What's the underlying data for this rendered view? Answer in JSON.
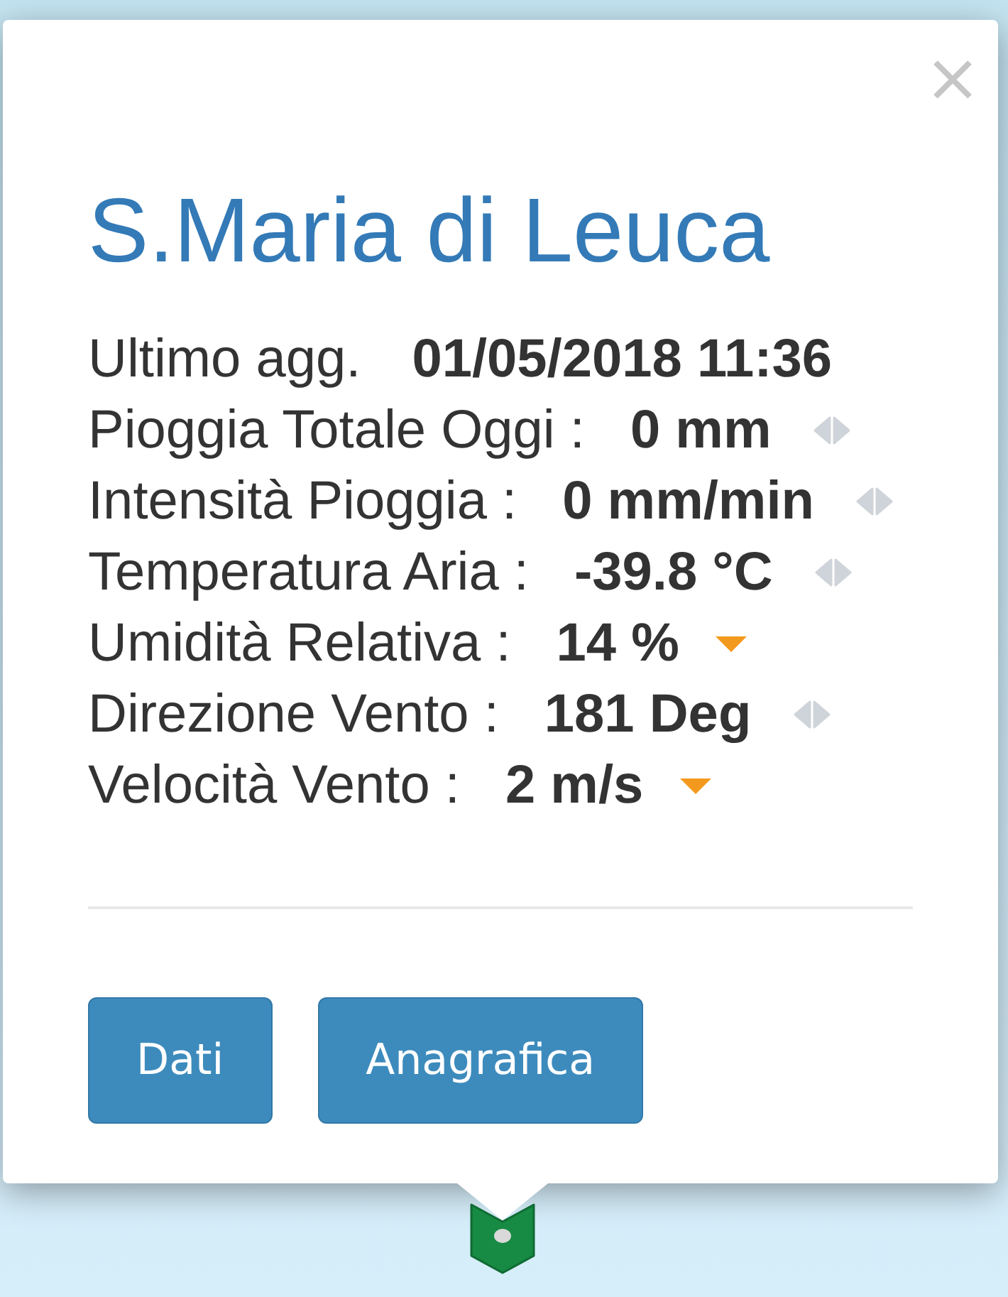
{
  "popup": {
    "title": "S.Maria di Leuca",
    "updated": {
      "label": "Ultimo agg.",
      "value": "01/05/2018 11:36"
    },
    "readings": [
      {
        "label": "Pioggia Totale Oggi :",
        "value": "0 mm",
        "kind": "steady"
      },
      {
        "label": "Intensità Pioggia :",
        "value": "0 mm/min",
        "kind": "steady"
      },
      {
        "label": "Temperatura Aria :",
        "value": "-39.8 °C",
        "kind": "steady"
      },
      {
        "label": "Umidità Relativa :",
        "value": "14 %",
        "kind": "down"
      },
      {
        "label": "Direzione Vento :",
        "value": "181 Deg",
        "kind": "steady"
      },
      {
        "label": "Velocità Vento :",
        "value": "2 m/s",
        "kind": "down"
      }
    ],
    "buttons": [
      "Dati",
      "Anagrafica"
    ]
  }
}
